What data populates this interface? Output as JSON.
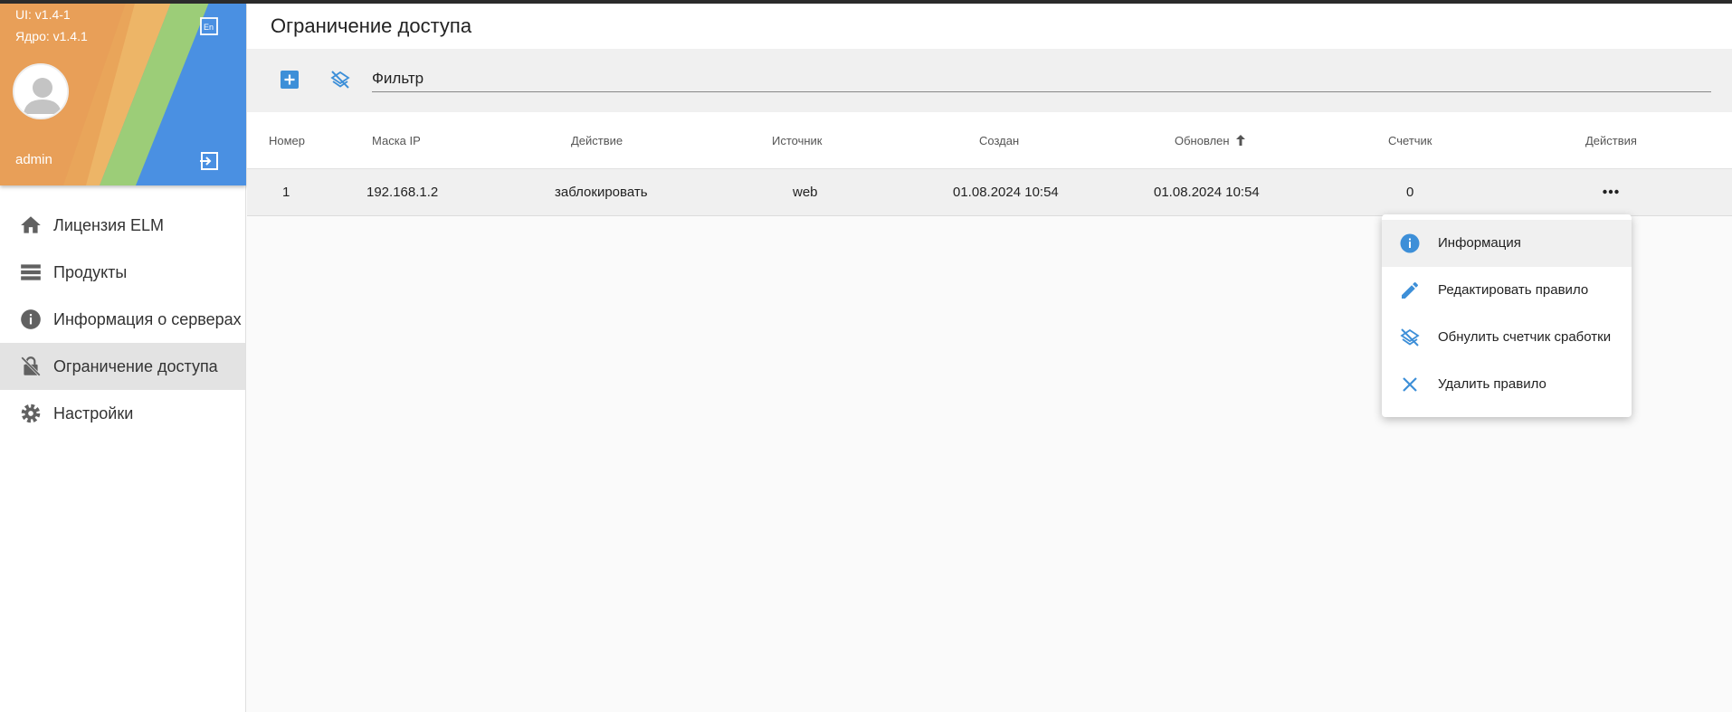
{
  "sidebar": {
    "ui_version": "UI: v1.4-1",
    "core_version": "Ядро: v1.4.1",
    "username": "admin",
    "items": [
      {
        "label": "Лицензия ELM",
        "icon": "home-icon"
      },
      {
        "label": "Продукты",
        "icon": "list-icon"
      },
      {
        "label": "Информация о серверах",
        "icon": "info-icon"
      },
      {
        "label": "Ограничение доступа",
        "icon": "lock-off-icon",
        "active": true
      },
      {
        "label": "Настройки",
        "icon": "gear-icon"
      }
    ]
  },
  "page": {
    "title": "Ограничение доступа"
  },
  "toolbar": {
    "filter_placeholder": "Фильтр"
  },
  "table": {
    "columns": [
      "Номер",
      "Маска IP",
      "Действие",
      "Источник",
      "Создан",
      "Обновлен",
      "Счетчик",
      "Действия"
    ],
    "sort": {
      "column": "Обновлен",
      "direction": "ascending"
    },
    "rows": [
      {
        "number": "1",
        "ip_mask": "192.168.1.2",
        "action": "заблокировать",
        "source": "web",
        "created": "01.08.2024 10:54",
        "updated": "01.08.2024 10:54",
        "counter": "0"
      }
    ]
  },
  "context_menu": {
    "items": [
      {
        "label": "Информация",
        "icon": "info-icon"
      },
      {
        "label": "Редактировать правило",
        "icon": "pencil-icon"
      },
      {
        "label": "Обнулить счетчик сработки",
        "icon": "layers-off-icon"
      },
      {
        "label": "Удалить правило",
        "icon": "close-icon"
      }
    ]
  },
  "colors": {
    "accent": "#3d8fd8",
    "icon_gray": "#616161",
    "active_nav_bg": "#e3e3e3"
  }
}
